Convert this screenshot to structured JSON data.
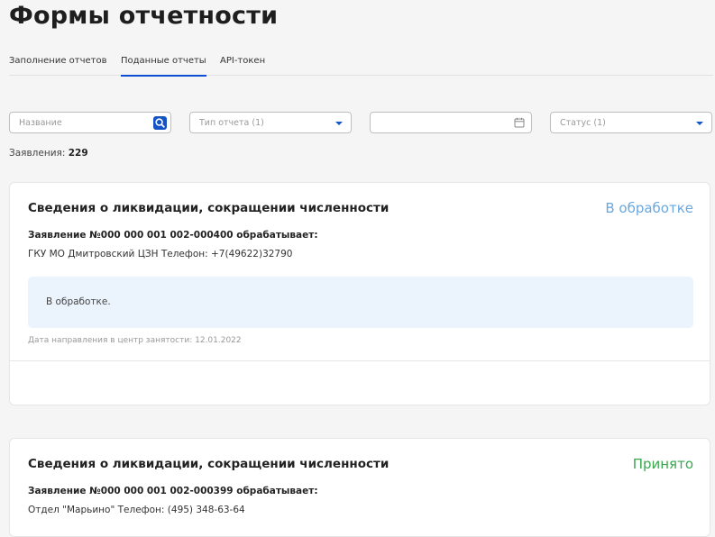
{
  "page": {
    "title": "Формы отчетности"
  },
  "tabs": [
    {
      "label": "Заполнение отчетов",
      "active": false
    },
    {
      "label": "Поданные отчеты",
      "active": true
    },
    {
      "label": "API-токен",
      "active": false
    }
  ],
  "filters": {
    "name_placeholder": "Название",
    "report_type": "Тип отчета (1)",
    "date_value": "",
    "status": "Статус (1)"
  },
  "summary": {
    "label": "Заявления:",
    "count": "229"
  },
  "cards": [
    {
      "title": "Сведения о ликвидации, сокращении численности",
      "status": "В обработке",
      "status_color": "#6aa8de",
      "application": "Заявление №000 000 001 002-000400 обрабатывает:",
      "organization": "ГКУ МО Дмитровский ЦЗН Телефон: +7(49622)32790",
      "note": "В обработке.",
      "date": "Дата направления в центр занятости: 12.01.2022"
    },
    {
      "title": "Сведения о ликвидации, сокращении численности",
      "status": "Принято",
      "status_color": "#3aa74f",
      "application": "Заявление №000 000 001 002-000399 обрабатывает:",
      "organization": "Отдел \"Марьино\" Телефон: (495) 348-63-64"
    }
  ],
  "colors": {
    "accent": "#0d4cd3",
    "note_bg": "#ebf3fd"
  }
}
